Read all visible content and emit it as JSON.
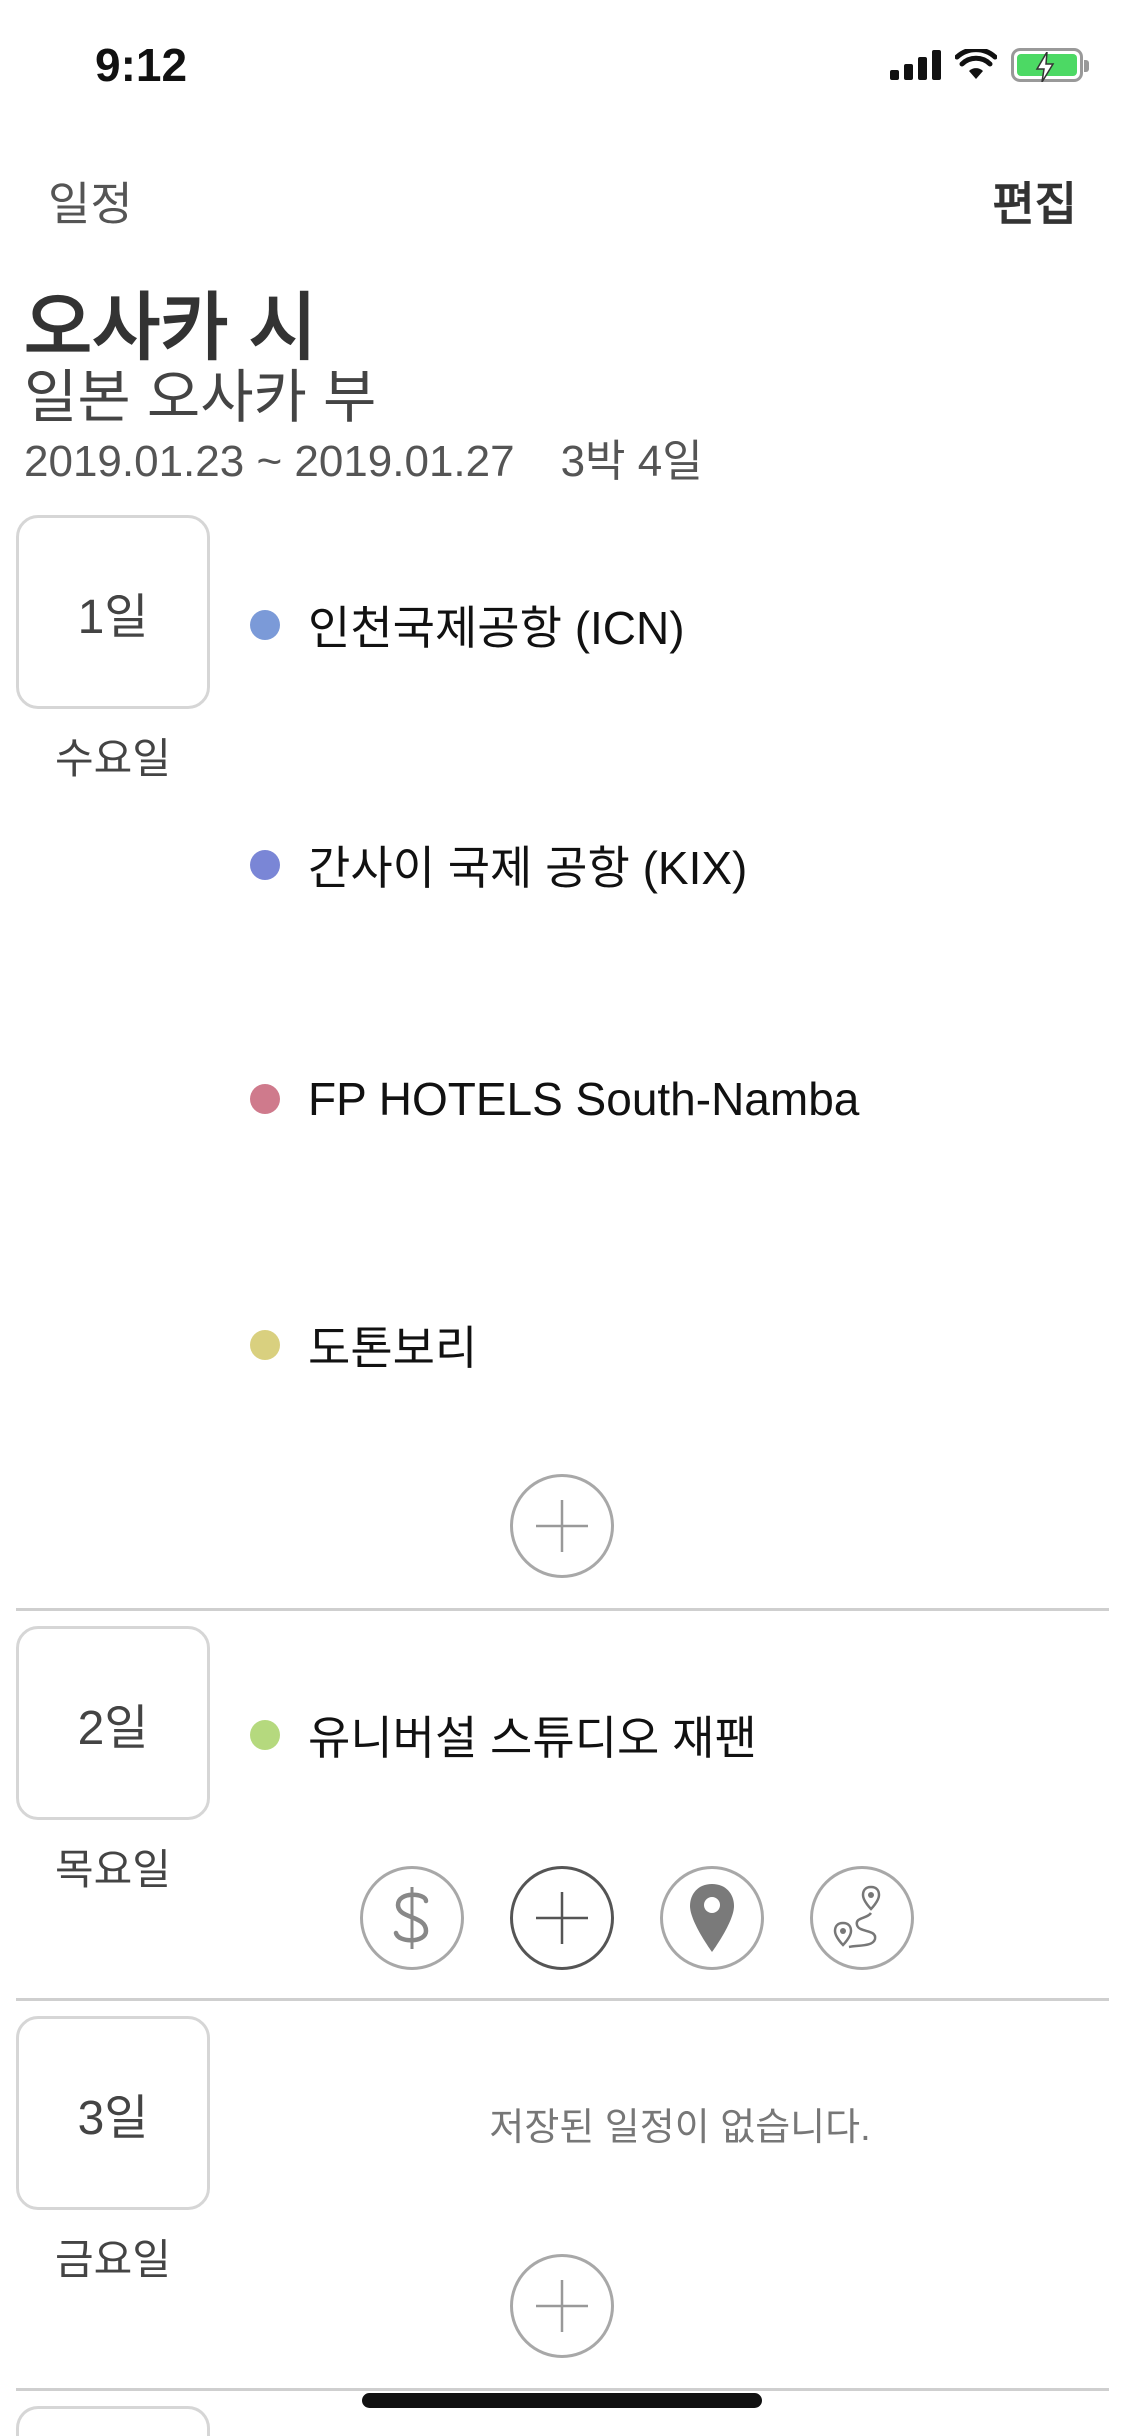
{
  "status_bar": {
    "time": "9:12"
  },
  "nav": {
    "back_label": "일정",
    "edit_label": "편집"
  },
  "trip": {
    "title": "오사카 시",
    "subtitle": "일본 오사카 부",
    "dates": "2019.01.23 ~ 2019.01.27",
    "duration": "3박 4일"
  },
  "days": [
    {
      "label": "1일",
      "weekday": "수요일",
      "places": [
        {
          "name": "인천국제공항 (ICN)",
          "color": "#7b9ad8"
        },
        {
          "name": "간사이 국제 공항 (KIX)",
          "color": "#7a86d6"
        },
        {
          "name": "FP HOTELS South-Namba",
          "color": "#cf7a8c"
        },
        {
          "name": "도톤보리",
          "color": "#d9d07f"
        }
      ]
    },
    {
      "label": "2일",
      "weekday": "목요일",
      "places": [
        {
          "name": "유니버설 스튜디오 재팬",
          "color": "#b5d97e"
        }
      ],
      "actions": [
        "dollar-icon",
        "plus-icon",
        "map-pin-icon",
        "route-icon"
      ]
    },
    {
      "label": "3일",
      "weekday": "금요일",
      "empty_message": "저장된 일정이 없습니다."
    }
  ]
}
